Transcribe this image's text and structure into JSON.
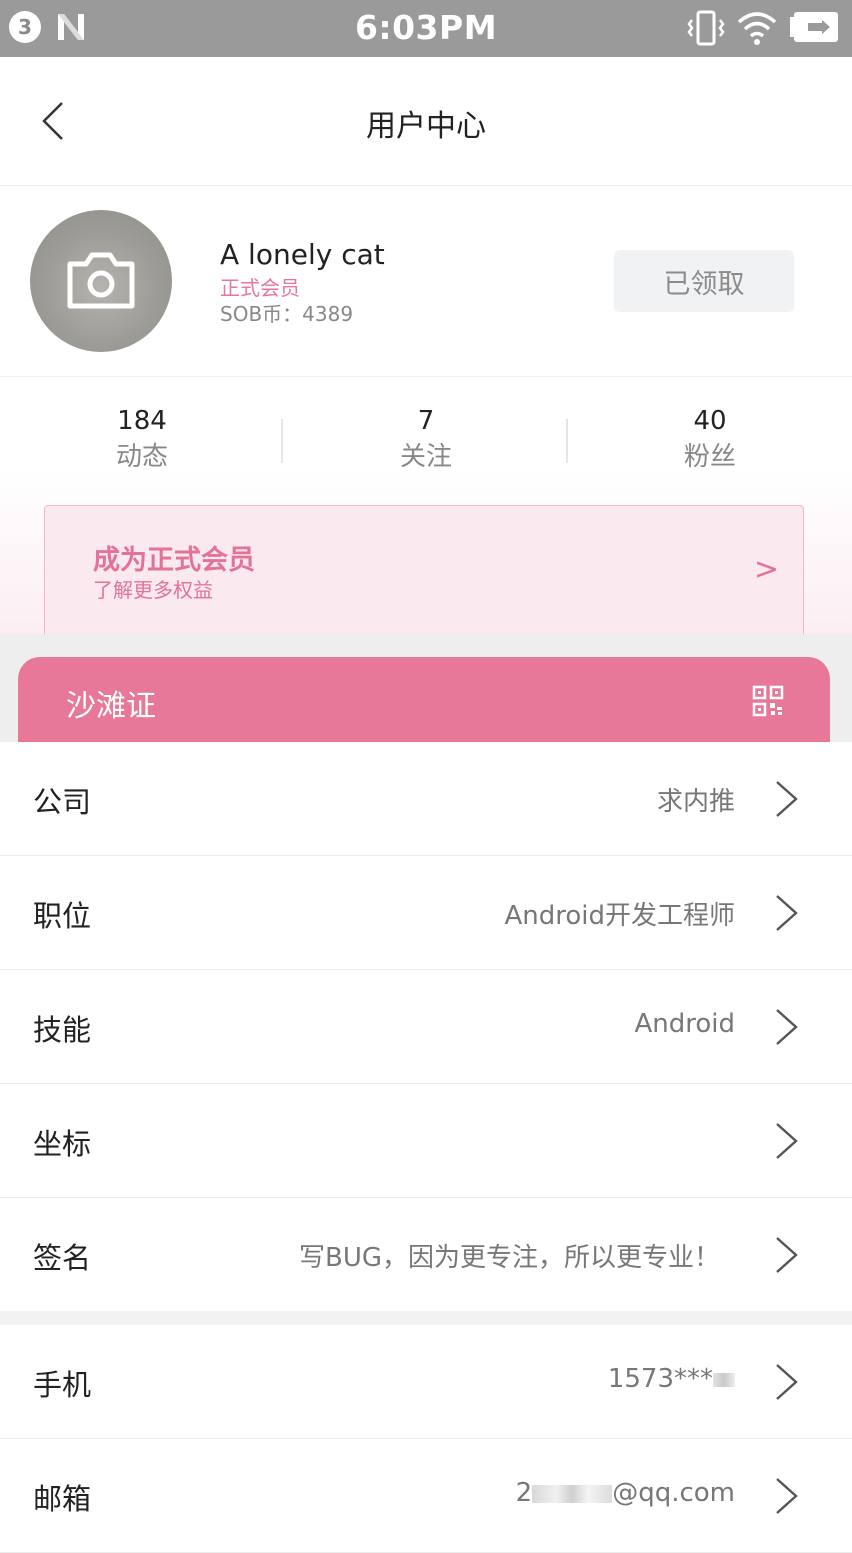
{
  "status_bar": {
    "badge": "3",
    "time": "6:03PM",
    "icons": [
      "notification-count-icon",
      "n-logo-icon",
      "vibrate-icon",
      "wifi-icon",
      "battery-icon"
    ]
  },
  "header": {
    "title": "用户中心",
    "back_icon": "chevron-left-icon"
  },
  "profile": {
    "avatar_icon": "camera-icon",
    "username": "A lonely cat",
    "member_status": "正式会员",
    "coins": "SOB币：4389",
    "received_label": "已领取"
  },
  "stats": [
    {
      "value": "184",
      "label": "动态"
    },
    {
      "value": "7",
      "label": "关注"
    },
    {
      "value": "40",
      "label": "粉丝"
    }
  ],
  "promo": {
    "title": "成为正式会员",
    "subtitle": "了解更多权益",
    "arrow": ">"
  },
  "beach_card": {
    "title": "沙滩证",
    "qr_icon": "qr-code-icon"
  },
  "rows": [
    {
      "label": "公司",
      "value": "求内推"
    },
    {
      "label": "职位",
      "value": "Android开发工程师"
    },
    {
      "label": "技能",
      "value": "Android"
    },
    {
      "label": "坐标",
      "value": ""
    },
    {
      "label": "签名",
      "value": "写BUG，因为更专注，所以更专业！"
    }
  ],
  "contact_rows": [
    {
      "label": "手机",
      "value_prefix": "1573***",
      "value_suffix": ""
    },
    {
      "label": "邮箱",
      "value_prefix": "2",
      "value_suffix": "@qq.com"
    }
  ],
  "colors": {
    "accent_pink": "#e87898",
    "promo_text": "#e3729a",
    "status_bar": "#9a9a9a"
  }
}
